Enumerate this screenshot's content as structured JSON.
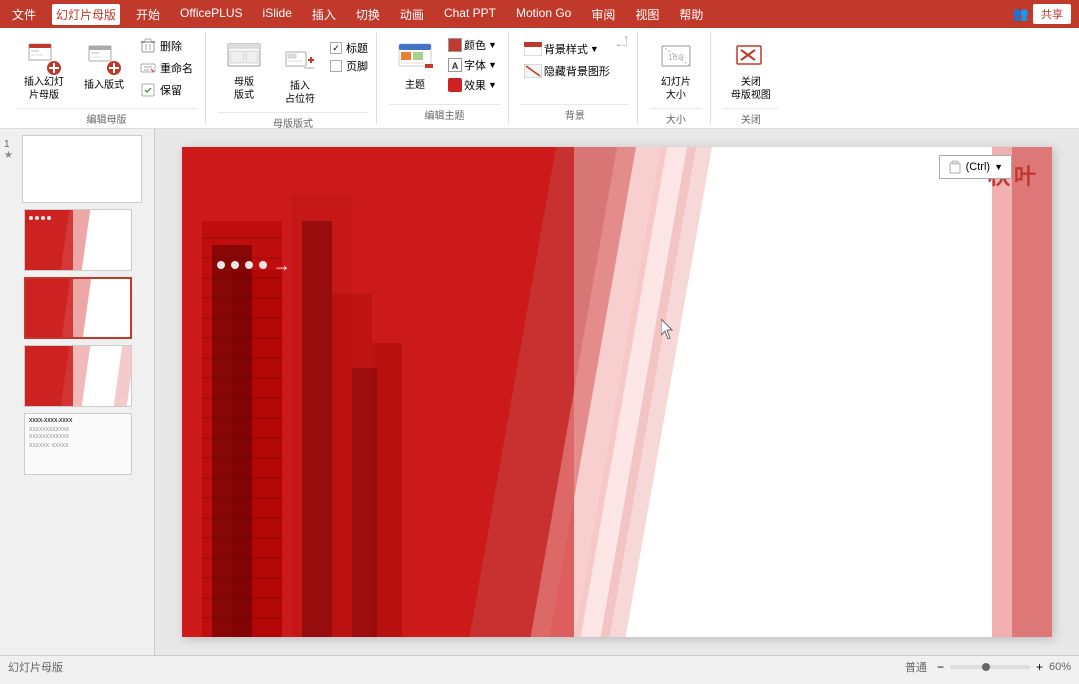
{
  "titlebar": {
    "tabs": [
      "文件",
      "幻灯片母版",
      "开始",
      "OfficePLUS",
      "iSlide",
      "插入",
      "切换",
      "动画",
      "Chat PPT",
      "Motion Go",
      "审阅",
      "视图",
      "帮助"
    ],
    "active_tab": "幻灯片母版",
    "share_button": "共享"
  },
  "ribbon": {
    "groups": [
      {
        "label": "编辑母版",
        "buttons": [
          {
            "id": "insert-slide-master",
            "icon": "insert-master",
            "text": "插入幻灯\n片母版"
          },
          {
            "id": "insert-layout",
            "icon": "insert-layout",
            "text": "插入版式"
          },
          {
            "id": "delete",
            "icon": "delete",
            "text": "删除"
          },
          {
            "id": "rename",
            "icon": "rename",
            "text": "重命名"
          },
          {
            "id": "preserve",
            "icon": "preserve",
            "text": "保留"
          }
        ]
      },
      {
        "label": "母版版式",
        "buttons": [
          {
            "id": "master-layout",
            "icon": "master-layout",
            "text": "母版\n版式"
          },
          {
            "id": "insert-placeholder",
            "icon": "insert-placeholder",
            "text": "插入\n占位符"
          }
        ],
        "checks": [
          "标题",
          "页脚"
        ]
      },
      {
        "label": "编辑主题",
        "buttons": [
          {
            "id": "theme",
            "icon": "theme",
            "text": "主题"
          }
        ],
        "colors": [
          "颜色",
          "字体",
          "效果"
        ]
      },
      {
        "label": "背景",
        "buttons": [
          "背景样式",
          "隐藏背景图形"
        ]
      },
      {
        "label": "大小",
        "buttons": [
          {
            "id": "slide-size",
            "text": "幻灯片\n大小"
          }
        ]
      },
      {
        "label": "关闭",
        "buttons": [
          {
            "id": "close-master",
            "text": "关闭\n母版视图",
            "icon": "close-red"
          }
        ]
      }
    ]
  },
  "slides": [
    {
      "num": "1",
      "active": false,
      "type": "red-white",
      "has_star": true
    },
    {
      "num": "",
      "active": false,
      "type": "red-white-small"
    },
    {
      "num": "",
      "active": true,
      "type": "red-white-small"
    },
    {
      "num": "",
      "active": false,
      "type": "red-white-small"
    },
    {
      "num": "",
      "active": false,
      "type": "text-slide"
    }
  ],
  "canvas": {
    "title_text": "秋叶",
    "dots": [
      "●",
      "●",
      "●",
      "●"
    ],
    "arrow": "→",
    "paste_label": "(Ctrl)"
  },
  "statusbar": {
    "slide_info": "幻灯片母版",
    "zoom": "普通",
    "zoom_level": "60%"
  }
}
